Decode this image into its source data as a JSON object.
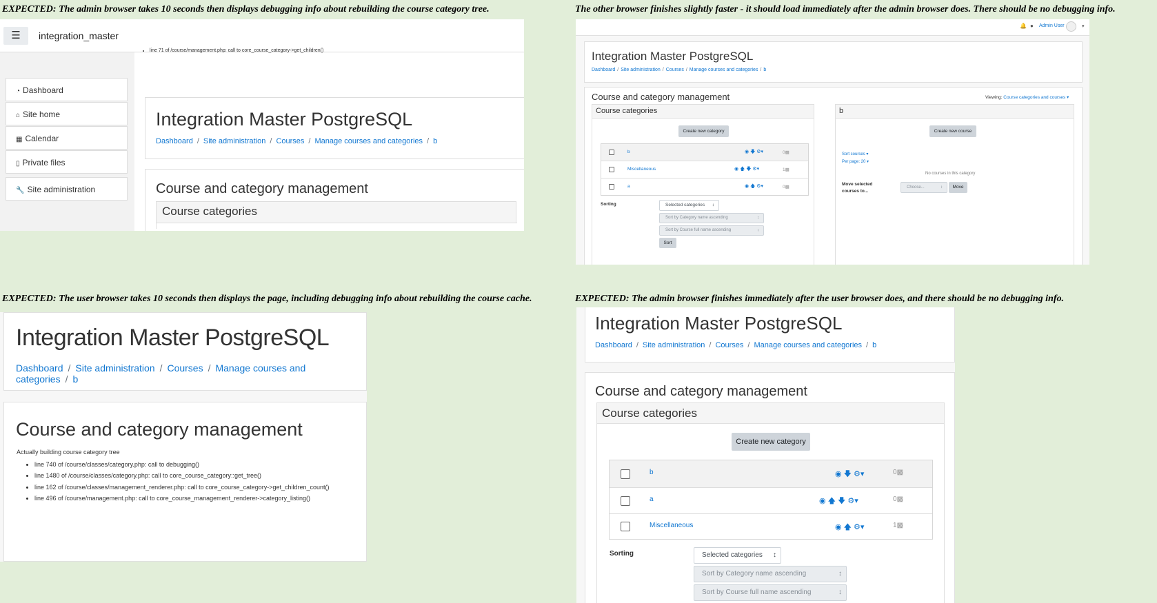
{
  "captions": {
    "tl": "EXPECTED: The admin browser takes 10 seconds then displays debugging info about rebuilding the course category tree.",
    "tr": "The other browser finishes slightly faster - it should load immediately after the admin browser does. There should be no debugging info.",
    "bl": "EXPECTED: The user browser takes 10 seconds then displays the page, including debugging info about rebuilding the course cache.",
    "br": "EXPECTED: The admin browser finishes immediately after the user browser does, and there should be no debugging info."
  },
  "site": {
    "title": "Integration Master PostgreSQL",
    "short_name": "integration_master",
    "breadcrumb": [
      "Dashboard",
      "Site administration",
      "Courses",
      "Manage courses and categories",
      "b"
    ]
  },
  "nav": {
    "menu_icon": "hamburger-icon",
    "items": [
      {
        "label": "Dashboard",
        "icon": "dashboard-icon"
      },
      {
        "label": "Site home",
        "icon": "home-icon"
      },
      {
        "label": "Calendar",
        "icon": "calendar-icon"
      },
      {
        "label": "Private files",
        "icon": "file-icon"
      },
      {
        "label": "Site administration",
        "icon": "wrench-icon"
      }
    ]
  },
  "management": {
    "heading": "Course and category management",
    "categories_heading": "Course categories",
    "create_category": "Create new category",
    "create_course": "Create new course",
    "viewing_label": "Viewing:",
    "viewing_value": "Course categories and courses",
    "sorting_label": "Sorting",
    "sort_select": "Selected categories",
    "sort_option_1": "Sort by Category name ascending",
    "sort_option_2": "Sort by Course full name ascending",
    "sort_button": "Sort",
    "sort_courses": "Sort courses",
    "per_page": "Per page: 20",
    "no_courses": "No courses in this category",
    "move_selected": "Move selected courses to...",
    "choose": "Choose...",
    "move_button": "Move",
    "course_pane_title": "b"
  },
  "categories_tr": [
    {
      "name": "b",
      "count": "0"
    },
    {
      "name": "Miscellaneous",
      "count": "1"
    },
    {
      "name": "a",
      "count": "0"
    }
  ],
  "categories_br": [
    {
      "name": "b",
      "count": "0"
    },
    {
      "name": "a",
      "count": "0"
    },
    {
      "name": "Miscellaneous",
      "count": "1"
    }
  ],
  "debug_tl": {
    "line": "line 71 of /course/management.php: call to core_course_category->get_children()"
  },
  "debug_bl": {
    "message": "Actually building course category tree",
    "lines": [
      "line 740 of /course/classes/category.php: call to debugging()",
      "line 1480 of /course/classes/category.php: call to core_course_category::get_tree()",
      "line 162 of /course/classes/management_renderer.php: call to core_course_category->get_children_count()",
      "line 496 of /course/management.php: call to core_course_management_renderer->category_listing()"
    ]
  },
  "user": {
    "name": "Admin User"
  }
}
